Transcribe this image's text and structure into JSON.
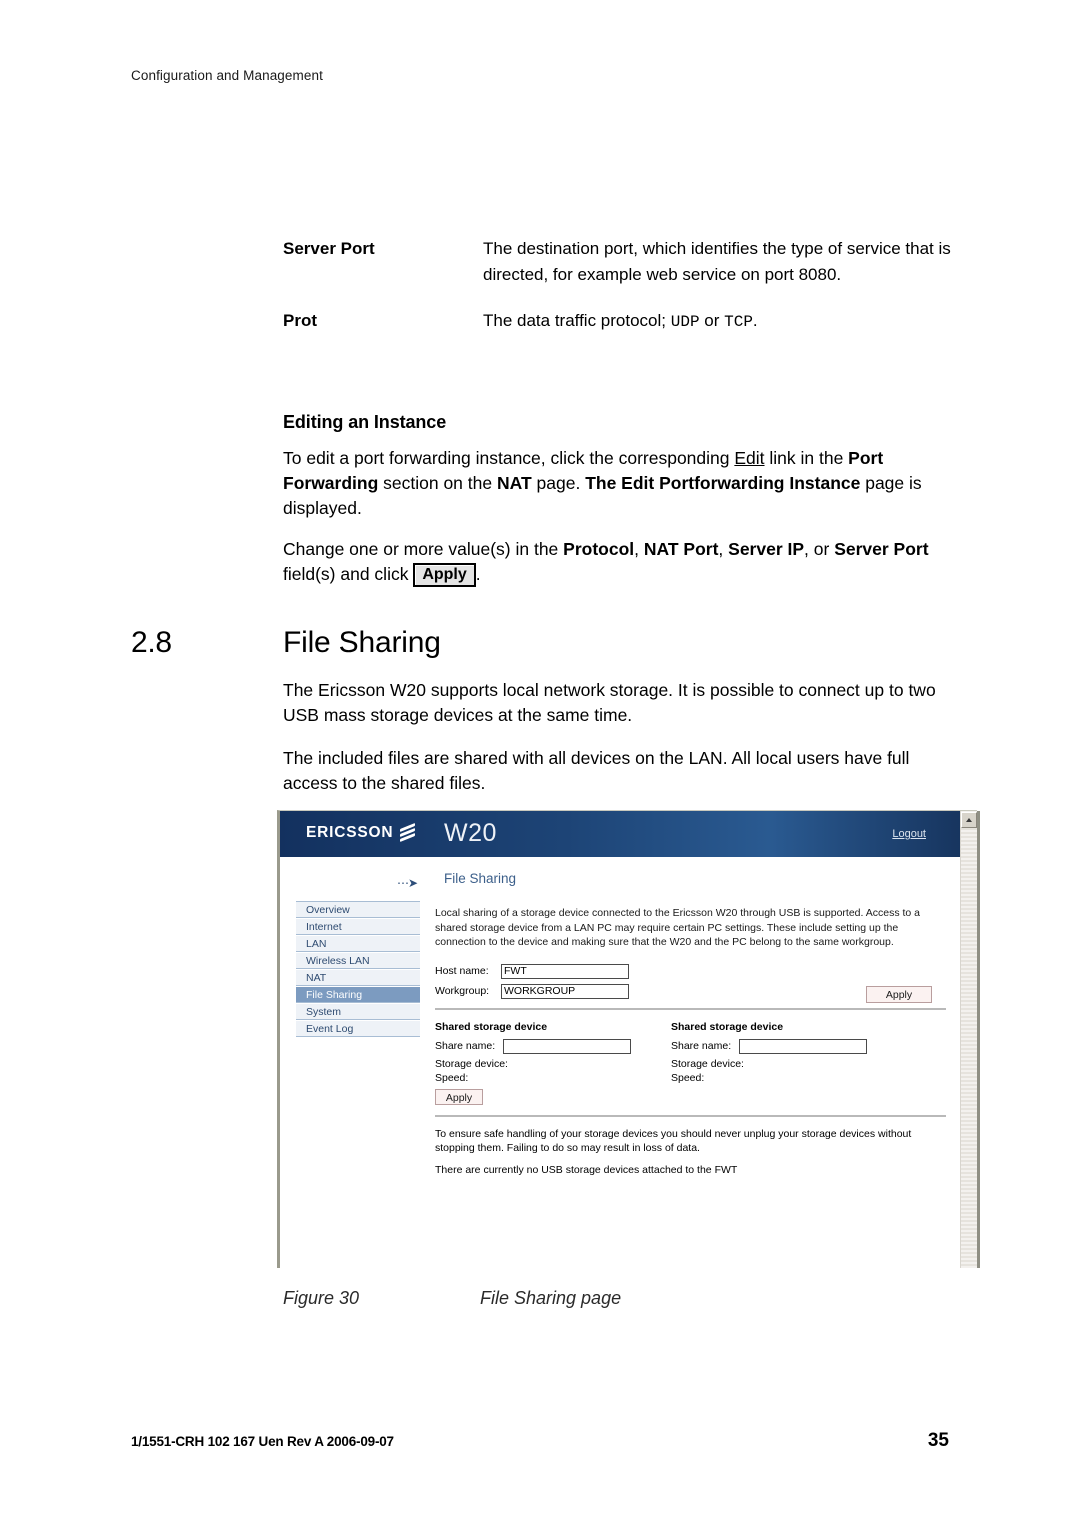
{
  "page": {
    "running_head": "Configuration and Management",
    "footer_id": "1/1551-CRH 102 167 Uen Rev A  2006-09-07",
    "page_number": "35"
  },
  "definitions": [
    {
      "term": "Server Port",
      "description": "The destination port, which identifies the type of service that is directed, for example web service on port 8080."
    },
    {
      "term": "Prot",
      "description_prefix": "The data traffic protocol; ",
      "mono_1": "UDP",
      "description_middle": " or ",
      "mono_2": "TCP",
      "description_suffix": "."
    }
  ],
  "editing_section": {
    "heading": "Editing an Instance",
    "paragraph_1": {
      "s1": "To edit a port forwarding instance, click the corresponding ",
      "link": "Edit",
      "s2": " link in the ",
      "b1": "Port Forwarding",
      "s3": " section on the ",
      "b2": "NAT",
      "s4": " page. ",
      "b3": "The Edit Portforwarding Instance",
      "s5": " page is displayed."
    },
    "paragraph_2": {
      "s1": "Change one or more value(s) in the ",
      "b1": "Protocol",
      "s2": ", ",
      "b2": "NAT Port",
      "s3": ", ",
      "b3": "Server IP",
      "s4": ", or ",
      "b4": "Server Port",
      "s5": " field(s) and click ",
      "button": "Apply",
      "s6": "."
    }
  },
  "chapter": {
    "number": "2.8",
    "title": "File Sharing",
    "paragraph_1": "The Ericsson W20 supports local network storage. It is possible to connect up to two USB mass storage devices at the same time.",
    "paragraph_2": "The included files are shared with all devices on the LAN. All local users have full access to the shared files."
  },
  "screenshot": {
    "banner": {
      "brand": "ERICSSON",
      "brand_mark": "ericsson-stripes-icon",
      "model": "W20",
      "logout": "Logout"
    },
    "breadcrumb": {
      "arrow_icon": "dotted-arrow-icon",
      "text": "File Sharing"
    },
    "sidebar": [
      {
        "label": "Overview",
        "active": false
      },
      {
        "label": "Internet",
        "active": false
      },
      {
        "label": "LAN",
        "active": false
      },
      {
        "label": "Wireless LAN",
        "active": false
      },
      {
        "label": "NAT",
        "active": false
      },
      {
        "label": "File Sharing",
        "active": true
      },
      {
        "label": "System",
        "active": false
      },
      {
        "label": "Event Log",
        "active": false
      }
    ],
    "blurb": "Local sharing of a storage device connected to the Ericsson W20 through USB is supported. Access to a shared storage device from a LAN PC may require certain PC settings. These include setting up the connection to the device and making sure that the W20 and the PC belong to the same workgroup.",
    "form": {
      "host_label": "Host name:",
      "host_value": "FWT",
      "workgroup_label": "Workgroup:",
      "workgroup_value": "WORKGROUP",
      "apply_label": "Apply"
    },
    "devices": [
      {
        "title": "Shared storage device",
        "share_label": "Share name:",
        "share_value": "",
        "storage_label": "Storage device:",
        "speed_label": "Speed:",
        "apply_label": "Apply"
      },
      {
        "title": "Shared storage device",
        "share_label": "Share name:",
        "share_value": "",
        "storage_label": "Storage device:",
        "speed_label": "Speed:"
      }
    ],
    "notice": {
      "line_1": "To ensure safe handling of your storage devices you should never unplug your storage devices without stopping them. Failing to do so may result in loss of data.",
      "line_2": "There are currently no USB storage devices attached to the FWT"
    },
    "scrollbar": {
      "up_arrow_icon": "scroll-up-arrow-icon"
    }
  },
  "figure": {
    "label": "Figure 30",
    "caption": "File Sharing page"
  },
  "colors": {
    "banner_navy": "#1d4476",
    "nav_active": "#7c9bc0",
    "nav_bg": "#eef2f7",
    "link_blue": "#3c5f8a",
    "button_face": "#fbf2f1"
  }
}
